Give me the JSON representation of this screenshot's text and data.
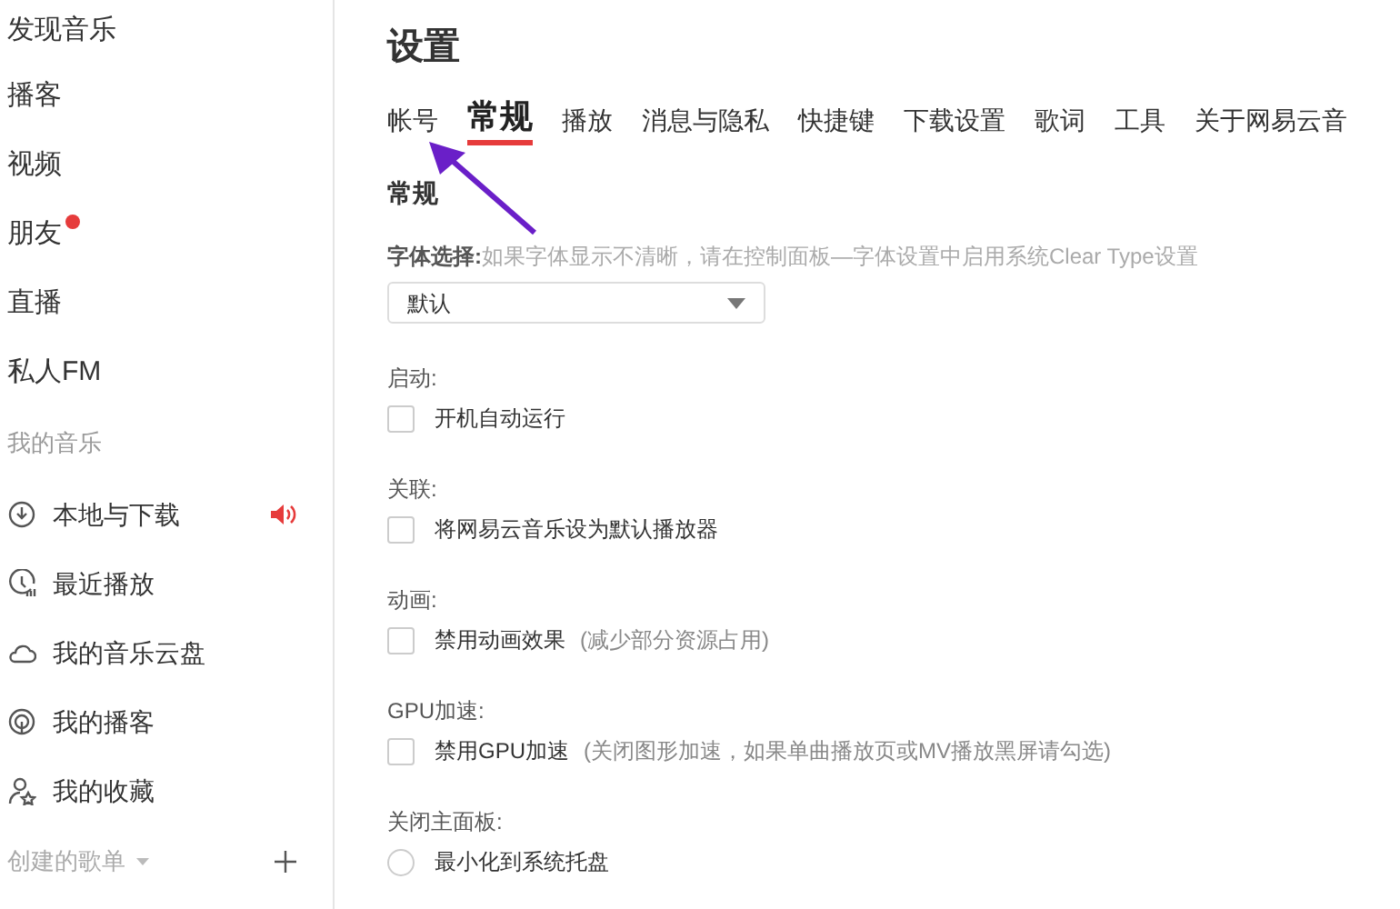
{
  "sidebar": {
    "items": [
      {
        "label": "发现音乐",
        "dot": false
      },
      {
        "label": "播客",
        "dot": false
      },
      {
        "label": "视频",
        "dot": false
      },
      {
        "label": "朋友",
        "dot": true
      },
      {
        "label": "直播",
        "dot": false
      },
      {
        "label": "私人FM",
        "dot": false
      }
    ],
    "my_music": {
      "title": "我的音乐",
      "items": [
        {
          "label": "本地与下载",
          "playing": true
        },
        {
          "label": "最近播放",
          "playing": false
        },
        {
          "label": "我的音乐云盘",
          "playing": false
        },
        {
          "label": "我的播客",
          "playing": false
        },
        {
          "label": "我的收藏",
          "playing": false
        }
      ]
    },
    "created_playlists": {
      "title": "创建的歌单"
    }
  },
  "main": {
    "title": "设置",
    "tabs": [
      {
        "label": "帐号",
        "selected": false
      },
      {
        "label": "常规",
        "selected": true
      },
      {
        "label": "播放",
        "selected": false
      },
      {
        "label": "消息与隐私",
        "selected": false
      },
      {
        "label": "快捷键",
        "selected": false
      },
      {
        "label": "下载设置",
        "selected": false
      },
      {
        "label": "歌词",
        "selected": false
      },
      {
        "label": "工具",
        "selected": false
      },
      {
        "label": "关于网易云音",
        "selected": false
      }
    ],
    "section_title": "常规",
    "font": {
      "label": "字体选择:",
      "hint": "如果字体显示不清晰，请在控制面板—字体设置中启用系统Clear Type设置",
      "value": "默认"
    },
    "groups": [
      {
        "label": "启动:",
        "options": [
          {
            "kind": "checkbox",
            "label": "开机自动运行",
            "checked": false
          }
        ]
      },
      {
        "label": "关联:",
        "options": [
          {
            "kind": "checkbox",
            "label": "将网易云音乐设为默认播放器",
            "checked": false
          }
        ]
      },
      {
        "label": "动画:",
        "options": [
          {
            "kind": "checkbox",
            "label": "禁用动画效果",
            "note": "(减少部分资源占用)",
            "checked": false
          }
        ]
      },
      {
        "label": "GPU加速:",
        "options": [
          {
            "kind": "checkbox",
            "label": "禁用GPU加速",
            "note": "(关闭图形加速，如果单曲播放页或MV播放黑屏请勾选)",
            "checked": false
          }
        ]
      },
      {
        "label": "关闭主面板:",
        "options": [
          {
            "kind": "radio",
            "label": "最小化到系统托盘",
            "checked": false
          }
        ]
      }
    ]
  }
}
